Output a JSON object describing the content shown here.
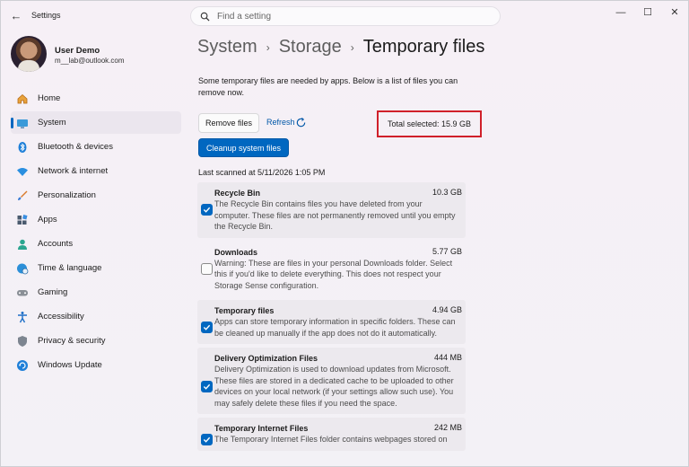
{
  "window": {
    "app_title": "Settings",
    "controls": {
      "minimize": "—",
      "maximize": "☐",
      "close": "✕"
    },
    "back_glyph": "←"
  },
  "search": {
    "placeholder": "Find a setting"
  },
  "profile": {
    "name": "User Demo",
    "email": "m__lab@outlook.com"
  },
  "sidebar": {
    "items": [
      {
        "label": "Home",
        "icon": "home-icon",
        "active": false
      },
      {
        "label": "System",
        "icon": "monitor-icon",
        "active": true
      },
      {
        "label": "Bluetooth & devices",
        "icon": "bluetooth-icon",
        "active": false
      },
      {
        "label": "Network & internet",
        "icon": "wifi-icon",
        "active": false
      },
      {
        "label": "Personalization",
        "icon": "brush-icon",
        "active": false
      },
      {
        "label": "Apps",
        "icon": "apps-icon",
        "active": false
      },
      {
        "label": "Accounts",
        "icon": "person-icon",
        "active": false
      },
      {
        "label": "Time & language",
        "icon": "globe-clock-icon",
        "active": false
      },
      {
        "label": "Gaming",
        "icon": "gamepad-icon",
        "active": false
      },
      {
        "label": "Accessibility",
        "icon": "accessibility-icon",
        "active": false
      },
      {
        "label": "Privacy & security",
        "icon": "shield-icon",
        "active": false
      },
      {
        "label": "Windows Update",
        "icon": "update-icon",
        "active": false
      }
    ]
  },
  "breadcrumb": {
    "items": [
      "System",
      "Storage",
      "Temporary files"
    ],
    "separator": "›"
  },
  "main": {
    "intro": "Some temporary files are needed by apps. Below is a list of files you can remove now.",
    "remove_button": "Remove files",
    "refresh_label": "Refresh",
    "total_selected": "Total selected: 15.9 GB",
    "cleanup_button": "Cleanup system files",
    "last_scanned": "Last scanned at 5/11/2026 1:05 PM"
  },
  "files": [
    {
      "name": "Recycle Bin",
      "size": "10.3 GB",
      "checked": true,
      "description": "The Recycle Bin contains files you have deleted from your computer. These files are not permanently removed until you empty the Recycle Bin."
    },
    {
      "name": "Downloads",
      "size": "5.77 GB",
      "checked": false,
      "description": "Warning: These are files in your personal Downloads folder. Select this if you'd like to delete everything. This does not respect your Storage Sense configuration."
    },
    {
      "name": "Temporary files",
      "size": "4.94 GB",
      "checked": true,
      "description": "Apps can store temporary information in specific folders. These can be cleaned up manually if the app does not do it automatically."
    },
    {
      "name": "Delivery Optimization Files",
      "size": "444 MB",
      "checked": true,
      "description": "Delivery Optimization is used to download updates from Microsoft. These files are stored in a dedicated cache to be uploaded to other devices on your local network (if your settings allow such use). You may safely delete these files if you need the space."
    },
    {
      "name": "Temporary Internet Files",
      "size": "242 MB",
      "checked": true,
      "description": "The Temporary Internet Files folder contains webpages stored on"
    }
  ],
  "colors": {
    "accent": "#0067c0",
    "highlight_border": "#d0202a"
  }
}
